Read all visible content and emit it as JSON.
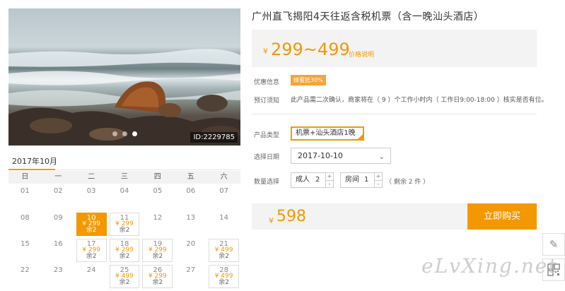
{
  "product": {
    "title": "广州直飞揭阳4天往返含税机票（含一晚汕头酒店）",
    "photo_id": "ID:2229785",
    "currency": "¥",
    "price_range": "299~499",
    "price_note": "价格说明"
  },
  "info": {
    "promo_label": "优惠信息",
    "promo_badge": "蜂蜜抵30%",
    "booking_label": "预订须知",
    "booking_text": "此产品需二次确认，商家将在（ 9 ）个工作小时内（ 工作日9:00-18:00 ）核实是否有位。"
  },
  "options": {
    "type_label": "产品类型",
    "type_value": "机票+汕头酒店1晚",
    "date_label": "选择日期",
    "date_value": "2017-10-10",
    "qty_label": "数量选择",
    "adult_label": "成人",
    "adult_value": "2",
    "room_label": "房间",
    "room_value": "1",
    "remaining": "（ 剩余 2 件 ）",
    "plus": "+",
    "minus": "-"
  },
  "purchase": {
    "currency": "¥",
    "total": "598",
    "buy_label": "立即购买"
  },
  "calendar": {
    "month_title": "2017年10月",
    "weekdays": [
      "日",
      "一",
      "二",
      "三",
      "四",
      "五",
      "六"
    ],
    "days": [
      {
        "num": "01"
      },
      {
        "num": "02"
      },
      {
        "num": "03"
      },
      {
        "num": "04"
      },
      {
        "num": "05"
      },
      {
        "num": "06"
      },
      {
        "num": "07"
      },
      {
        "num": "08"
      },
      {
        "num": "09"
      },
      {
        "num": "10",
        "price": "¥ 299",
        "stock": "余2",
        "selected": true
      },
      {
        "num": "11",
        "price": "¥ 299",
        "stock": "余2"
      },
      {
        "num": "12"
      },
      {
        "num": "13"
      },
      {
        "num": "14"
      },
      {
        "num": "15"
      },
      {
        "num": "16"
      },
      {
        "num": "17",
        "price": "¥ 299",
        "stock": "余2"
      },
      {
        "num": "18",
        "price": "¥ 299",
        "stock": "余2"
      },
      {
        "num": "19",
        "price": "¥ 299",
        "stock": "余2"
      },
      {
        "num": "20"
      },
      {
        "num": "21",
        "price": "¥ 499",
        "stock": "余2"
      },
      {
        "num": "22"
      },
      {
        "num": "23"
      },
      {
        "num": "24"
      },
      {
        "num": "25",
        "price": "¥ 499",
        "stock": "余2"
      },
      {
        "num": "26",
        "price": "¥ 299",
        "stock": "余2"
      },
      {
        "num": "27"
      },
      {
        "num": "28",
        "price": "¥ 499",
        "stock": "余2"
      }
    ]
  },
  "side": {
    "edit_icon": "pencil-icon",
    "qr_icon": "qr-code-icon"
  },
  "watermark": "eLvXing.net",
  "colors": {
    "accent": "#f39800",
    "panel": "#f3f3f3"
  }
}
